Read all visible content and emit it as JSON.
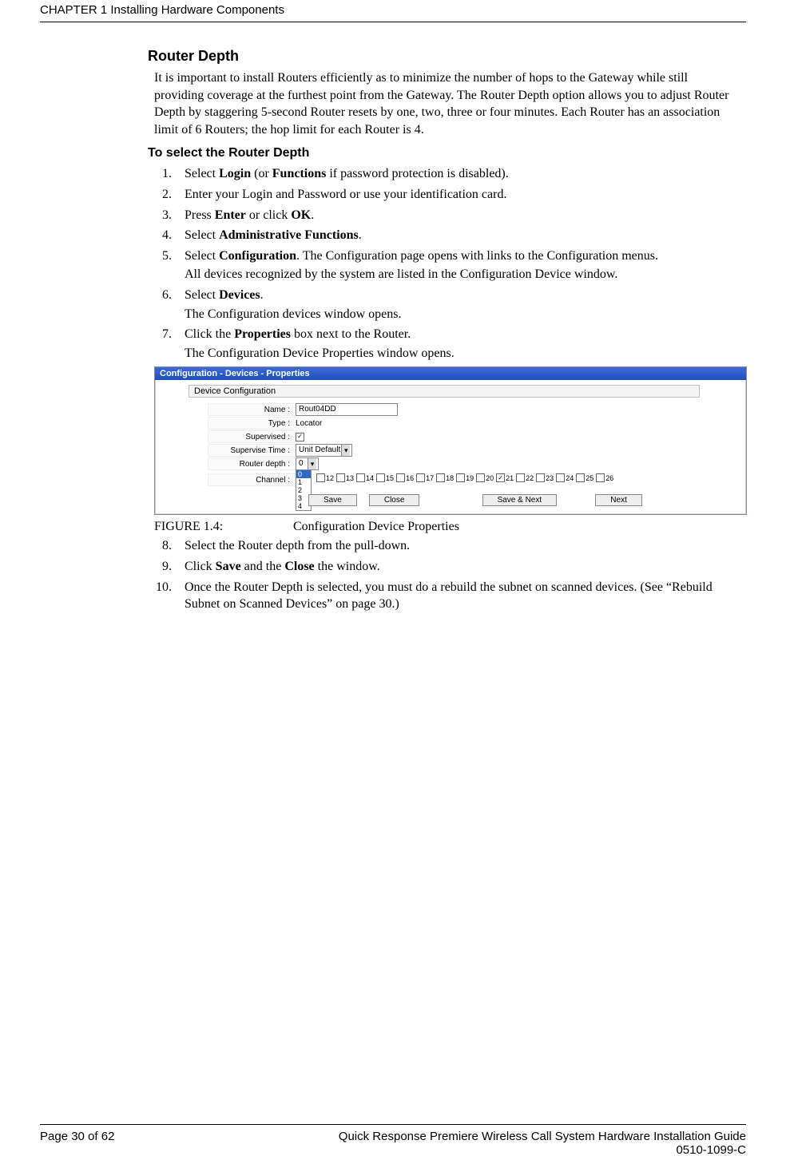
{
  "header": {
    "chapter_line": "CHAPTER 1 Installing Hardware Components"
  },
  "section": {
    "title": "Router Depth",
    "intro": "It is important to install Routers efficiently as to minimize the number of hops to the Gateway while still providing coverage at the furthest point from the Gateway. The Router Depth option allows you to adjust Router Depth by staggering 5-second Router resets by one, two, three or four minutes. Each Router has an association limit of 6 Routers; the hop limit for each Router is 4.",
    "subhead": "To select the Router Depth",
    "steps": [
      {
        "pre": "Select ",
        "b1": "Login",
        "mid": " (or ",
        "b2": "Functions",
        "post": " if password protection is disabled)."
      },
      {
        "pre": "Enter your Login and Password or use your identification card."
      },
      {
        "pre": "Press ",
        "b1": "Enter",
        "mid": " or click ",
        "b2": "OK",
        "post": "."
      },
      {
        "pre": "Select ",
        "b1": "Administrative Functions",
        "post": "."
      },
      {
        "pre": "Select ",
        "b1": "Configuration",
        "post": ". The Configuration page opens with links to the Configuration menus.",
        "after": "All devices recognized by the system are listed in the Configuration Device window."
      },
      {
        "pre": "Select ",
        "b1": "Devices",
        "post": ".",
        "after": "The Configuration devices window opens."
      },
      {
        "pre": "Click the ",
        "b1": "Properties",
        "post": " box next to the Router.",
        "after": "The Configuration Device Properties window opens."
      }
    ],
    "steps2": [
      {
        "pre": "Select the Router depth from the pull-down."
      },
      {
        "pre": "Click ",
        "b1": "Save",
        "mid": " and the ",
        "b2": "Close",
        "post": " the window."
      },
      {
        "pre": "Once the Router Depth is selected, you must do a rebuild the subnet on scanned devices. (See “Rebuild Subnet on Scanned Devices” on page 30.)"
      }
    ],
    "figure": {
      "label": "FIGURE 1.4:",
      "caption": "Configuration Device Properties"
    }
  },
  "config_panel": {
    "titlebar": "Configuration - Devices - Properties",
    "section_label": "Device Configuration",
    "rows": {
      "name": {
        "label": "Name :",
        "value": "Rout04DD"
      },
      "type": {
        "label": "Type :",
        "value": "Locator"
      },
      "supervised": {
        "label": "Supervised :",
        "checked": true
      },
      "supervise_time": {
        "label": "Supervise Time :",
        "value": "Unit Default"
      },
      "router_depth": {
        "label": "Router depth :",
        "options": [
          "0",
          "1",
          "2",
          "3",
          "4"
        ],
        "selected": "0"
      },
      "channel": {
        "label": "Channel :"
      }
    },
    "channels": [
      {
        "n": "12",
        "c": false
      },
      {
        "n": "13",
        "c": false
      },
      {
        "n": "14",
        "c": false
      },
      {
        "n": "15",
        "c": false
      },
      {
        "n": "16",
        "c": false
      },
      {
        "n": "17",
        "c": false
      },
      {
        "n": "18",
        "c": false
      },
      {
        "n": "19",
        "c": false
      },
      {
        "n": "20",
        "c": false
      },
      {
        "n": "21",
        "c": true
      },
      {
        "n": "22",
        "c": false
      },
      {
        "n": "23",
        "c": false
      },
      {
        "n": "24",
        "c": false
      },
      {
        "n": "25",
        "c": false
      },
      {
        "n": "26",
        "c": false
      }
    ],
    "buttons": {
      "save": "Save",
      "close": "Close",
      "save_next": "Save & Next",
      "next": "Next"
    }
  },
  "footer": {
    "page": "Page 30 of 62",
    "title": "Quick Response Premiere Wireless Call System Hardware Installation Guide",
    "doc_no": "0510-1099-C"
  }
}
